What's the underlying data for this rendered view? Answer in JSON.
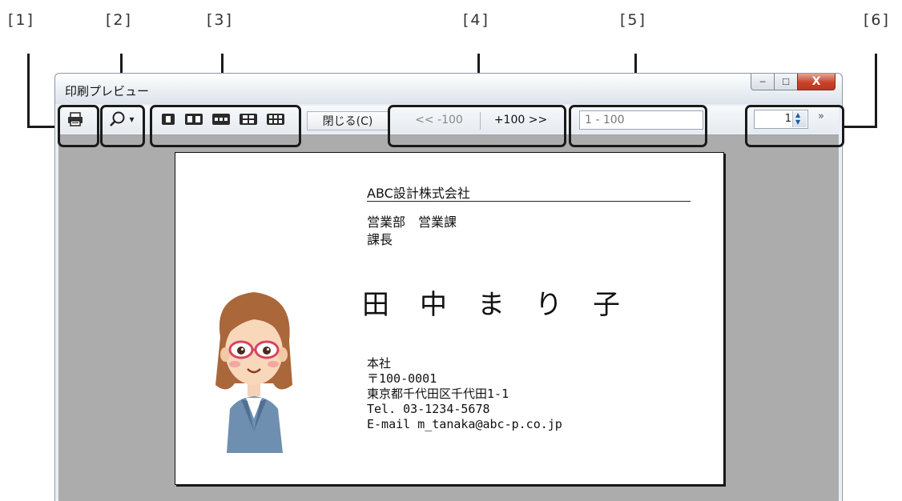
{
  "callouts": [
    "[1]",
    "[2]",
    "[3]",
    "[4]",
    "[5]",
    "[6]"
  ],
  "window": {
    "title": "印刷プレビュー",
    "minimize_glyph": "─",
    "maximize_glyph": "☐",
    "close_glyph": "X"
  },
  "toolbar": {
    "print_icon": "printer-icon",
    "zoom_icon": "magnifier-icon",
    "zoom_arrow": "▾",
    "page_layout_icons": [
      "one-page-icon",
      "two-pages-icon",
      "three-pages-icon",
      "four-pages-icon",
      "six-pages-icon"
    ],
    "close_label": "閉じる(C)",
    "prev_label": "<< -100",
    "next_label": "+100 >>",
    "range_value": "1 - 100",
    "page_number": "1",
    "more_glyph": "»"
  },
  "card": {
    "company": "ABC設計株式会社",
    "department": "営業部　営業課\n課長",
    "name": "田　中　ま　り　子",
    "address": "本社\n〒100-0001\n東京都千代田区千代田1-1\nTel. 03-1234-5678\nE-mail m_tanaka@abc-p.co.jp"
  },
  "colors": {
    "canvas": "#acacac",
    "close_button": "#c9432b",
    "callout_border": "#1a1a1a"
  }
}
